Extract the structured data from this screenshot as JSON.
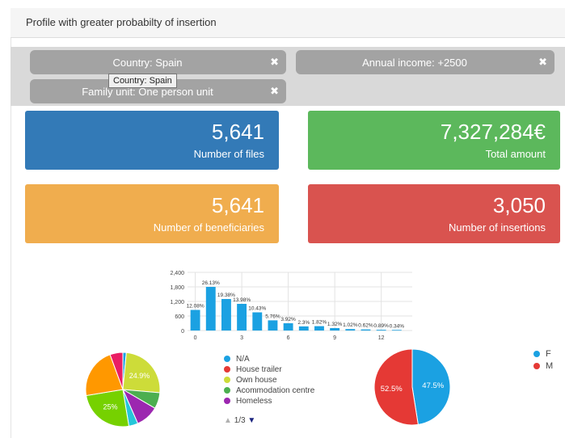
{
  "panel": {
    "title": "Profile with greater probabilty of insertion"
  },
  "filters": [
    {
      "label": "Country: Spain",
      "remove_icon": "close-icon"
    },
    {
      "label": "Annual income: +2500",
      "remove_icon": "close-icon"
    },
    {
      "label": "Family unit: One person unit",
      "remove_icon": "close-icon"
    }
  ],
  "tooltip": {
    "text": "Country: Spain"
  },
  "stats": {
    "files": {
      "value": "5,641",
      "label": "Number of files",
      "color": "#337ab7"
    },
    "amount": {
      "value": "7,327,284€",
      "label": "Total amount",
      "color": "#5cb85c"
    },
    "beneficiaries": {
      "value": "5,641",
      "label": "Number of beneficiaries",
      "color": "#f0ad4e"
    },
    "insertions": {
      "value": "3,050",
      "label": "Number of insertions",
      "color": "#d9534f"
    }
  },
  "chart_data": [
    {
      "type": "bar",
      "x": [
        0,
        1,
        2,
        3,
        4,
        5,
        6,
        7,
        8,
        9,
        10,
        11,
        12,
        13
      ],
      "values": [
        850,
        1800,
        1300,
        1100,
        750,
        420,
        300,
        170,
        180,
        100,
        60,
        45,
        30,
        25
      ],
      "data_labels": [
        "12.08%",
        "26.13%",
        "19.38%",
        "13.98%",
        "10.43%",
        "5.76%",
        "3.92%",
        "2.3%",
        "1.82%",
        "1.32%",
        "1.02%",
        "0.62%",
        "0.89%",
        "0.34%"
      ],
      "y_ticks": [
        "0",
        "600",
        "1,200",
        "1,800",
        "2,400"
      ],
      "x_ticks": [
        "0",
        "3",
        "6",
        "9",
        "12"
      ],
      "ylim": [
        0,
        2400
      ],
      "xlim": [
        -0.5,
        14
      ],
      "grid": true,
      "color": "#1ba1e2"
    },
    {
      "type": "pie",
      "slices": [
        {
          "label": "",
          "value": 1.5,
          "color": "#1ba1e2"
        },
        {
          "label": "",
          "value": 24.9,
          "color": "#cddc39"
        },
        {
          "label": "",
          "value": 7,
          "color": "#4caf50"
        },
        {
          "label": "",
          "value": 10,
          "color": "#9c27b0"
        },
        {
          "label": "",
          "value": 4,
          "color": "#26c6da"
        },
        {
          "label": "",
          "value": 25,
          "color": "#76d100"
        },
        {
          "label": "",
          "value": 22,
          "color": "#ff9800"
        },
        {
          "label": "",
          "value": 5.6,
          "color": "#e91e63"
        }
      ],
      "slice_labels": [
        "24.9%",
        "25%"
      ],
      "legend": [
        {
          "label": "N/A",
          "color": "#1ba1e2"
        },
        {
          "label": "House trailer",
          "color": "#e53935"
        },
        {
          "label": "Own house",
          "color": "#cddc39"
        },
        {
          "label": "Acommodation centre",
          "color": "#4caf50"
        },
        {
          "label": "Homeless",
          "color": "#9c27b0"
        }
      ],
      "legend_pager": {
        "text": "1/3"
      }
    },
    {
      "type": "pie",
      "slices": [
        {
          "label": "F",
          "value": 47.5,
          "color": "#1ba1e2"
        },
        {
          "label": "M",
          "value": 52.5,
          "color": "#e53935"
        }
      ],
      "slice_labels": [
        "47.5%",
        "52.5%"
      ],
      "legend": [
        {
          "label": "F",
          "color": "#1ba1e2"
        },
        {
          "label": "M",
          "color": "#e53935"
        }
      ]
    }
  ]
}
